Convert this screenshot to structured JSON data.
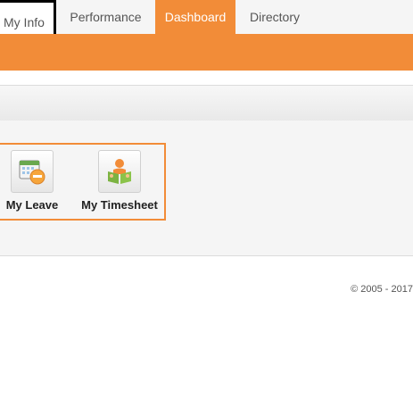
{
  "tabs": {
    "my_info": "My Info",
    "performance": "Performance",
    "dashboard": "Dashboard",
    "directory": "Directory"
  },
  "active_tab": "Dashboard",
  "quick_launch": {
    "items": [
      {
        "label": "My Leave",
        "icon": "calendar-clock-icon"
      },
      {
        "label": "My Timesheet",
        "icon": "person-reading-icon"
      }
    ]
  },
  "footer": {
    "copyright": "© 2005 - 2017"
  },
  "colors": {
    "accent": "#f28c38",
    "tab_text": "#555555",
    "panel_bg": "#f5f5f5"
  }
}
